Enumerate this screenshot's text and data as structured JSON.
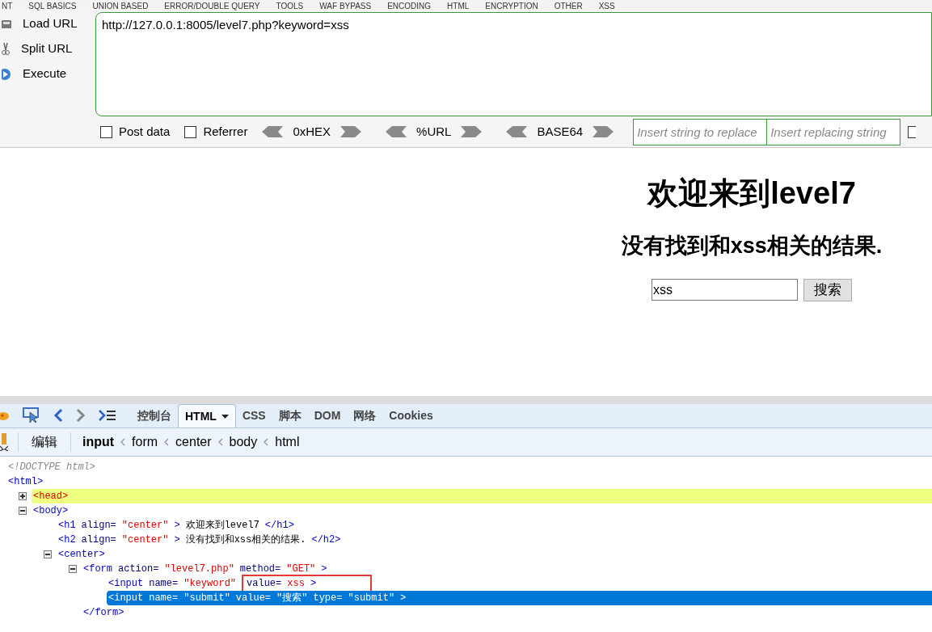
{
  "menu": [
    "NT",
    "SQL BASICS",
    "UNION BASED",
    "ERROR/DOUBLE QUERY",
    "TOOLS",
    "WAF BYPASS",
    "ENCODING",
    "HTML",
    "ENCRYPTION",
    "OTHER",
    "XSS"
  ],
  "hackbar": {
    "actions": [
      {
        "label": "Load URL",
        "kind": "load"
      },
      {
        "label": "Split URL",
        "kind": "split"
      },
      {
        "label": "Execute",
        "kind": "execute"
      }
    ],
    "url": "http://127.0.0.1:8005/level7.php?keyword=xss",
    "options": [
      {
        "label": "Post data",
        "checked": false
      },
      {
        "label": "Referrer",
        "checked": false
      }
    ],
    "encoders": [
      "0xHEX",
      "%URL",
      "BASE64"
    ],
    "replace_fields": [
      {
        "placeholder": "Insert string to replace"
      },
      {
        "placeholder": "Insert replacing string"
      }
    ],
    "trailing_checkbox": {
      "checked": false
    }
  },
  "page": {
    "title": "欢迎来到level7",
    "subtitle": "没有找到和xss相关的结果.",
    "search_value": "xss",
    "search_button": "搜索"
  },
  "devtools": {
    "tabs": [
      {
        "label": "控制台",
        "selected": false,
        "dropdown": false
      },
      {
        "label": "HTML",
        "selected": true,
        "dropdown": true
      },
      {
        "label": "CSS",
        "selected": false,
        "dropdown": false
      },
      {
        "label": "脚本",
        "selected": false,
        "dropdown": false
      },
      {
        "label": "DOM",
        "selected": false,
        "dropdown": false
      },
      {
        "label": "网络",
        "selected": false,
        "dropdown": false
      },
      {
        "label": "Cookies",
        "selected": false,
        "dropdown": false
      }
    ],
    "edit_button": "编辑",
    "breadcrumbs": [
      {
        "label": "input",
        "selected": true
      },
      {
        "label": "form",
        "selected": false
      },
      {
        "label": "center",
        "selected": false
      },
      {
        "label": "body",
        "selected": false
      },
      {
        "label": "html",
        "selected": false
      }
    ],
    "tree": [
      {
        "tokens": [
          {
            "kind": "doctype",
            "text": "<!DOCTYPE html>"
          }
        ]
      },
      {
        "tokens": [
          {
            "kind": "tag",
            "text": "<html>"
          }
        ],
        "children": [
          {
            "tokens": [
              {
                "kind": "keyword",
                "text": "<head>"
              }
            ],
            "expanded": false,
            "highlighted": true,
            "selected": false
          },
          {
            "tokens": [
              {
                "kind": "tag",
                "text": "<body>"
              }
            ],
            "expanded": true,
            "highlighted": false,
            "selected": false,
            "children": [
              {
                "tokens": [
                  {
                    "kind": "tag",
                    "text": "<h1"
                  },
                  {
                    "kind": "attr",
                    "text": "align="
                  },
                  {
                    "kind": "value",
                    "text": "\"center\""
                  },
                  {
                    "kind": "tag",
                    "text": ">"
                  },
                  {
                    "kind": "text",
                    "text": "欢迎来到level7"
                  },
                  {
                    "kind": "tag",
                    "text": "</h1>"
                  }
                ]
              },
              {
                "tokens": [
                  {
                    "kind": "tag",
                    "text": "<h2"
                  },
                  {
                    "kind": "attr",
                    "text": "align="
                  },
                  {
                    "kind": "value",
                    "text": "\"center\""
                  },
                  {
                    "kind": "tag",
                    "text": ">"
                  },
                  {
                    "kind": "text",
                    "text": "没有找到和xss相关的结果."
                  },
                  {
                    "kind": "tag",
                    "text": "</h2>"
                  }
                ]
              },
              {
                "tokens": [
                  {
                    "kind": "tag",
                    "text": "<center>"
                  }
                ],
                "expanded": true,
                "highlighted": false,
                "selected": false,
                "children": [
                  {
                    "tokens": [
                      {
                        "kind": "tag",
                        "text": "<form"
                      },
                      {
                        "kind": "attr",
                        "text": "action="
                      },
                      {
                        "kind": "value",
                        "text": "\"level7.php\""
                      },
                      {
                        "kind": "attr",
                        "text": "method="
                      },
                      {
                        "kind": "value",
                        "text": "\"GET\""
                      },
                      {
                        "kind": "tag",
                        "text": ">"
                      }
                    ],
                    "expanded": true,
                    "highlighted": false,
                    "selected": false,
                    "children": [
                      {
                        "tokens": [
                          {
                            "kind": "tag",
                            "text": "<input"
                          },
                          {
                            "kind": "attr",
                            "text": "name="
                          },
                          {
                            "kind": "value",
                            "text": "\"keyword\""
                          },
                          {
                            "kind": "attr",
                            "text": "value=",
                            "boxed": true
                          },
                          {
                            "kind": "value",
                            "text": "xss",
                            "boxed": true
                          },
                          {
                            "kind": "tag",
                            "text": ">",
                            "boxed": true
                          }
                        ],
                        "highlighted": false,
                        "selected": false
                      },
                      {
                        "tokens": [
                          {
                            "kind": "tag",
                            "text": "<input"
                          },
                          {
                            "kind": "attr",
                            "text": "name="
                          },
                          {
                            "kind": "value",
                            "text": "\"submit\""
                          },
                          {
                            "kind": "attr",
                            "text": "value="
                          },
                          {
                            "kind": "value",
                            "text": "\"搜索\""
                          },
                          {
                            "kind": "attr",
                            "text": "type="
                          },
                          {
                            "kind": "value",
                            "text": "\"submit\""
                          },
                          {
                            "kind": "tag",
                            "text": ">"
                          }
                        ],
                        "highlighted": false,
                        "selected": true
                      }
                    ]
                  },
                  {
                    "tokens": [
                      {
                        "kind": "tag",
                        "text": "</form>"
                      }
                    ]
                  }
                ]
              }
            ]
          }
        ]
      }
    ]
  }
}
